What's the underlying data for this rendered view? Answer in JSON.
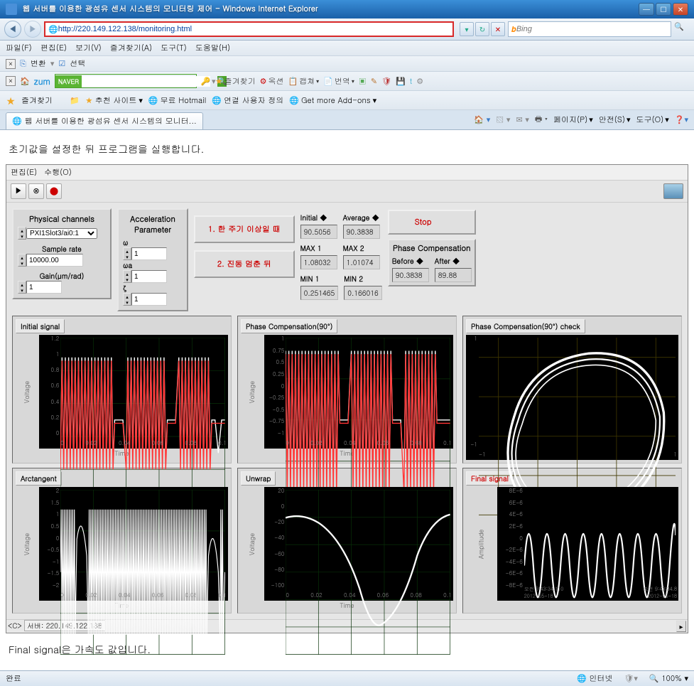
{
  "window": {
    "title": "웹 서버를 이용한 광섬유 센서 시스템의 모니터링 제어 - Windows Internet Explorer"
  },
  "address": {
    "url": "http://220.149.122.138/monitoring.html",
    "search_placeholder": "Bing"
  },
  "menus": {
    "file": "파일(F)",
    "edit": "편집(E)",
    "view": "보기(V)",
    "favorites": "즐겨찾기(A)",
    "tools": "도구(T)",
    "help": "도움말(H)"
  },
  "toolbar2": {
    "convert": "변환",
    "select": "선택"
  },
  "toolbar3": {
    "home": "zum",
    "naver": "NAVER",
    "fav": "즐겨찾기",
    "option": "옥션",
    "capture": "캡쳐",
    "translate": "번역"
  },
  "favbar": {
    "favorites": "즐겨찾기",
    "recommend": "추천 사이트",
    "hotmail": "무료 Hotmail",
    "userdef": "연결 사용자 정의",
    "addons": "Get more Add-ons"
  },
  "tab": {
    "title": "웹 서버를 이용한 광섬유 센서 시스템의 모니터..."
  },
  "tabtools": {
    "page": "페이지(P)",
    "safety": "안전(S)",
    "tools": "도구(O)"
  },
  "content": {
    "intro": "초기값을 설정한 뒤 프로그램을 실행합니다.",
    "outro": "Final signal은 가속도 값입니다."
  },
  "vi": {
    "menu_edit": "편집(E)",
    "menu_run": "수행(O)",
    "physical_channels": "Physical channels",
    "channel_value": "PXI1Slot3/ai0:1",
    "sample_rate": "Sample rate",
    "sample_rate_value": "10000.00",
    "gain": "Gain(μm/rad)",
    "gain_value": "1",
    "accel_param": "Acceleration Parameter",
    "w_label": "ω",
    "w_value": "1",
    "wa_label": "ωa",
    "wa_value": "1",
    "z_label": "ζ",
    "z_value": "1",
    "btn1": "1. 한 주기 이상일 때",
    "btn2": "2. 진동 멈춘 뒤",
    "initial": "Initial ◆",
    "initial_value": "90.5056",
    "average": "Average ◆",
    "average_value": "90.3838",
    "max1": "MAX 1",
    "max1_value": "1.08032",
    "max2": "MAX 2",
    "max2_value": "1.01074",
    "min1": "MIN 1",
    "min1_value": "0.251465",
    "min2": "MIN 2",
    "min2_value": "0.166016",
    "stop": "Stop",
    "phase_comp": "Phase Compensation",
    "before": "Before ◆",
    "before_value": "90.3838",
    "after": "After ◆",
    "after_value": "89.88",
    "scroll_left": "<C>",
    "scroll_server": "서버: 220.149.122.138"
  },
  "chart_data": [
    {
      "id": "initial",
      "title": "Initial signal",
      "type": "line",
      "xlabel": "Time",
      "ylabel": "Voltage",
      "xticks": [
        "0",
        "0.02",
        "0.04",
        "0.06",
        "0.08",
        "0.1"
      ],
      "yticks": [
        "1.2",
        "1",
        "0.8",
        "0.6",
        "0.4",
        "0.2",
        "0"
      ]
    },
    {
      "id": "phase90",
      "title": "Phase Compensation(90°)",
      "type": "line",
      "xlabel": "Time",
      "ylabel": "Voltage",
      "xticks": [
        "0",
        "0.02",
        "0.04",
        "0.06",
        "0.08",
        "0.1"
      ],
      "yticks": [
        "1",
        "0.75",
        "0.5",
        "0.25",
        "0",
        "-0.25",
        "-0.5",
        "-0.75",
        "-1"
      ]
    },
    {
      "id": "phase90check",
      "title": "Phase Compensation(90°) check",
      "type": "lissajous",
      "xticks": [
        "-1",
        "1"
      ],
      "yticks": [
        "1",
        "-1"
      ]
    },
    {
      "id": "arctan",
      "title": "Arctangent",
      "type": "line",
      "xlabel": "Time",
      "ylabel": "Voltage",
      "xticks": [
        "0",
        "0.02",
        "0.04",
        "0.06",
        "0.08",
        "0.1"
      ],
      "yticks": [
        "2",
        "1.5",
        "1",
        "0.5",
        "0",
        "-0.5",
        "-1",
        "-1.5",
        "-2"
      ]
    },
    {
      "id": "unwrap",
      "title": "Unwrap",
      "type": "line",
      "xlabel": "Time",
      "ylabel": "Voltage",
      "xticks": [
        "0",
        "0.02",
        "0.04",
        "0.06",
        "0.08",
        "0.1"
      ],
      "yticks": [
        "20",
        "0",
        "-20",
        "-40",
        "-60",
        "-80",
        "-100"
      ]
    },
    {
      "id": "final",
      "title": "Final signal",
      "type": "line",
      "xlabel": "",
      "ylabel": "Amplitude",
      "xticks_left": "오전 9:43:34.110",
      "xticks_right": "오전 9:43:34.8",
      "xticks_date": "2012-05-18",
      "yticks": [
        "8E-6",
        "6E-6",
        "4E-6",
        "2E-6",
        "0",
        "-2E-6",
        "-4E-6",
        "-6E-6",
        "-8E-6"
      ]
    }
  ],
  "status": {
    "done": "완료",
    "internet": "인터넷",
    "zoom": "100%"
  }
}
